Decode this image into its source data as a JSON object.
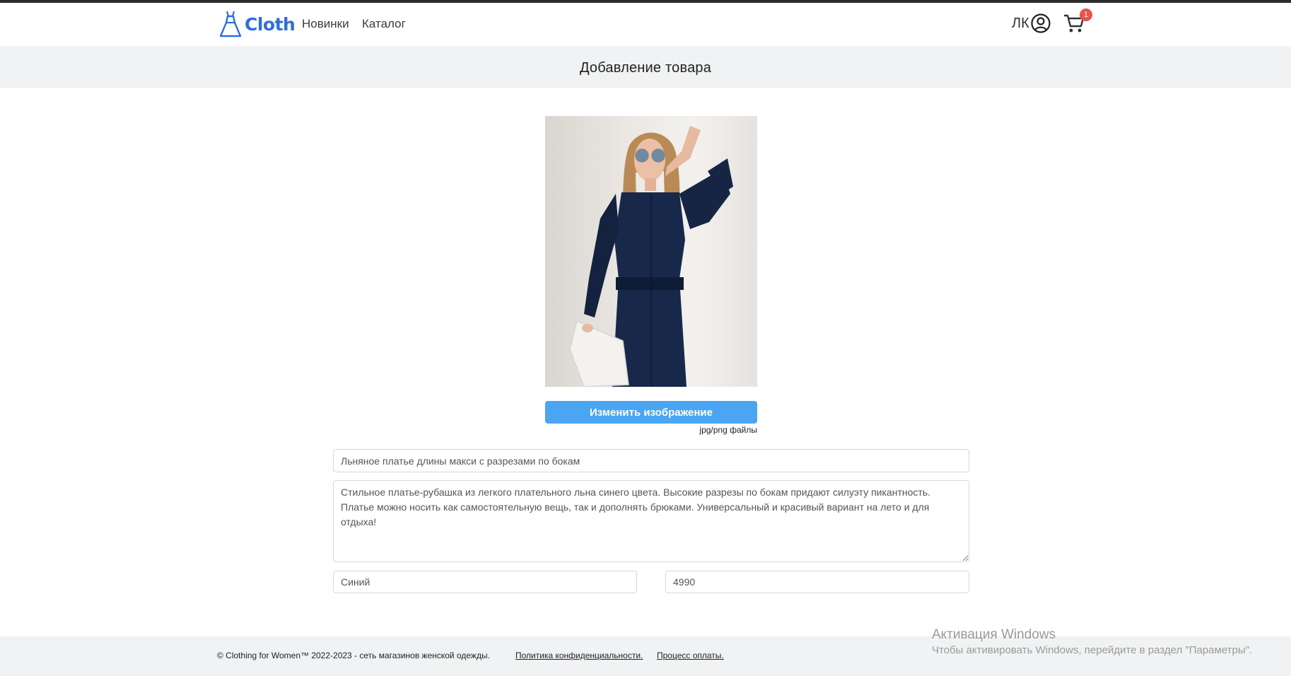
{
  "header": {
    "brand": "Cloth",
    "nav": [
      {
        "label": "Новинки"
      },
      {
        "label": "Каталог"
      }
    ],
    "account_label": "ЛК",
    "cart_count": "1"
  },
  "page_title": "Добавление товара",
  "product_form": {
    "change_image_label": "Изменить изображение",
    "file_hint": "jpg/png файлы",
    "name_value": "Льняное платье длины макси с разрезами по бокам",
    "description_value": "Стильное платье-рубашка из легкого плательного льна синего цвета. Высокие разрезы по бокам придают силуэту пикантность. Платье можно носить как самостоятельную вещь, так и дополнять брюками. Универсальный и красивый вариант на лето и для отдыха!",
    "color_value": "Синий",
    "price_value": "4990"
  },
  "footer": {
    "copyright": "© Clothing for Women™ 2022-2023 - сеть магазинов женской одежды.",
    "links": [
      {
        "label": "Политика конфиденциальности."
      },
      {
        "label": "Процесс оплаты."
      }
    ]
  },
  "watermark": {
    "title": "Активация Windows",
    "subtitle": "Чтобы активировать Windows, перейдите в раздел \"Параметры\"."
  },
  "icons": {
    "brand": "dress-icon",
    "account": "user-circle-icon",
    "cart": "shopping-cart-icon"
  },
  "colors": {
    "brand": "#2f6fd6",
    "button": "#4aa6f2",
    "badge": "#e8524f",
    "title_bar": "#f1f2f3"
  }
}
